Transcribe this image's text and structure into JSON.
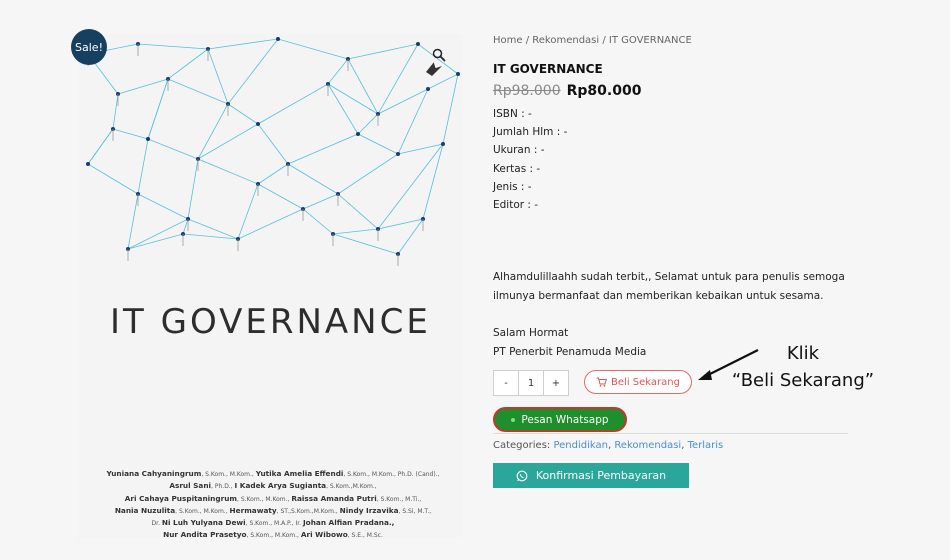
{
  "sale_badge": "Sale!",
  "cover": {
    "title": "IT GOVERNANCE",
    "authors_lines": [
      [
        {
          "t": "Yuniana Cahyaningrum",
          "b": true
        },
        {
          "t": ", S.Kom., M.Kom., ",
          "b": false
        },
        {
          "t": "Yutika Amelia Effendi",
          "b": true
        },
        {
          "t": ", S.Kom., M.Kom., Ph.D. (Cand).,",
          "b": false
        }
      ],
      [
        {
          "t": "Asrul Sani",
          "b": true
        },
        {
          "t": ", Ph.D., ",
          "b": false
        },
        {
          "t": "I Kadek Arya Sugianta",
          "b": true
        },
        {
          "t": ", S.Kom.,M.Kom.,",
          "b": false
        }
      ],
      [
        {
          "t": "Ari Cahaya Puspitaningrum",
          "b": true
        },
        {
          "t": ", S.Kom., M.Kom., ",
          "b": false
        },
        {
          "t": "Raissa Amanda Putri",
          "b": true
        },
        {
          "t": ", S.Kom., M.Ti.,",
          "b": false
        }
      ],
      [
        {
          "t": "Nania Nuzulita",
          "b": true
        },
        {
          "t": ", S.Kom., M.Kom., ",
          "b": false
        },
        {
          "t": "Hermawaty",
          "b": true
        },
        {
          "t": ", ST.,S.Kom.,M.Kom., ",
          "b": false
        },
        {
          "t": "Nindy Irzavika",
          "b": true
        },
        {
          "t": ", S.Si, M.T.,",
          "b": false
        }
      ],
      [
        {
          "t": "Dr. ",
          "b": false
        },
        {
          "t": "Ni Luh Yulyana Dewi",
          "b": true
        },
        {
          "t": ", S.Kom., M.A.P., Ir. ",
          "b": false
        },
        {
          "t": "Johan Alfian Pradana.,",
          "b": true
        }
      ],
      [
        {
          "t": "Nur Andita Prasetyo",
          "b": true
        },
        {
          "t": ", S.Kom., M.Kom., ",
          "b": false
        },
        {
          "t": "Ari Wibowo",
          "b": true
        },
        {
          "t": ", S.E., M.Sc.",
          "b": false
        }
      ]
    ]
  },
  "breadcrumb": {
    "home": "Home",
    "sep": " / ",
    "cat": "Rekomendasi",
    "current": "IT GOVERNANCE"
  },
  "product": {
    "title": "IT GOVERNANCE",
    "old_price": "Rp98.000",
    "new_price": "Rp80.000",
    "attributes": [
      "ISBN : -",
      "Jumlah Hlm : -",
      "Ukuran : -",
      "Kertas : -",
      "Jenis : -",
      "Editor : -"
    ],
    "description_1": "Alhamdulillaahh sudah terbit,, Selamat untuk para penulis semoga",
    "description_2": "ilmunya bermanfaat dan memberikan kebaikan untuk sesama.",
    "salam_1": "Salam Hormat",
    "salam_2": "PT Penerbit Penamuda Media"
  },
  "cart": {
    "minus": "-",
    "qty": "1",
    "plus": "+",
    "buy_label": "Beli Sekarang",
    "whatsapp_label": "Pesan Whatsapp"
  },
  "categories": {
    "label": "Categories: ",
    "items": [
      "Pendidikan",
      "Rekomendasi",
      "Terlaris"
    ]
  },
  "confirm_label": "Konfirmasi Pembayaran",
  "annotation": {
    "line1": "Klik",
    "line2": "“Beli Sekarang”"
  },
  "colors": {
    "sale": "#173f5f",
    "whatsapp": "#1f8f2d",
    "confirm": "#2ba69a",
    "buy": "#e05555",
    "link": "#4a8fd0"
  }
}
